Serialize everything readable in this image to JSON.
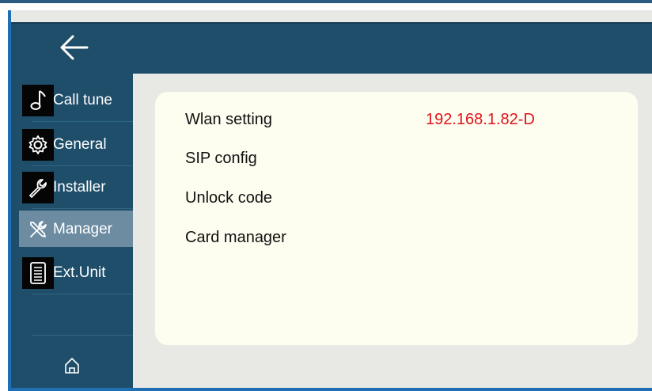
{
  "header": {
    "back_icon": "arrow-left-icon"
  },
  "sidebar": {
    "items": [
      {
        "label": "Call tune",
        "icon": "music-note-icon"
      },
      {
        "label": "General",
        "icon": "gear-icon"
      },
      {
        "label": "Installer",
        "icon": "wrench-icon"
      },
      {
        "label": "Manager",
        "icon": "tools-icon",
        "active": true
      },
      {
        "label": "Ext.Unit",
        "icon": "document-icon"
      }
    ],
    "home_icon": "home-icon"
  },
  "main": {
    "rows": [
      {
        "label": "Wlan setting",
        "value": "192.168.1.82-D"
      },
      {
        "label": "SIP config",
        "value": ""
      },
      {
        "label": "Unlock code",
        "value": ""
      },
      {
        "label": "Card manager",
        "value": ""
      }
    ]
  },
  "colors": {
    "nav_bg": "#1f4e6a",
    "active_item": "#6d8ca2",
    "panel_bg": "#fdfdf0",
    "value_red": "#e0141c"
  }
}
